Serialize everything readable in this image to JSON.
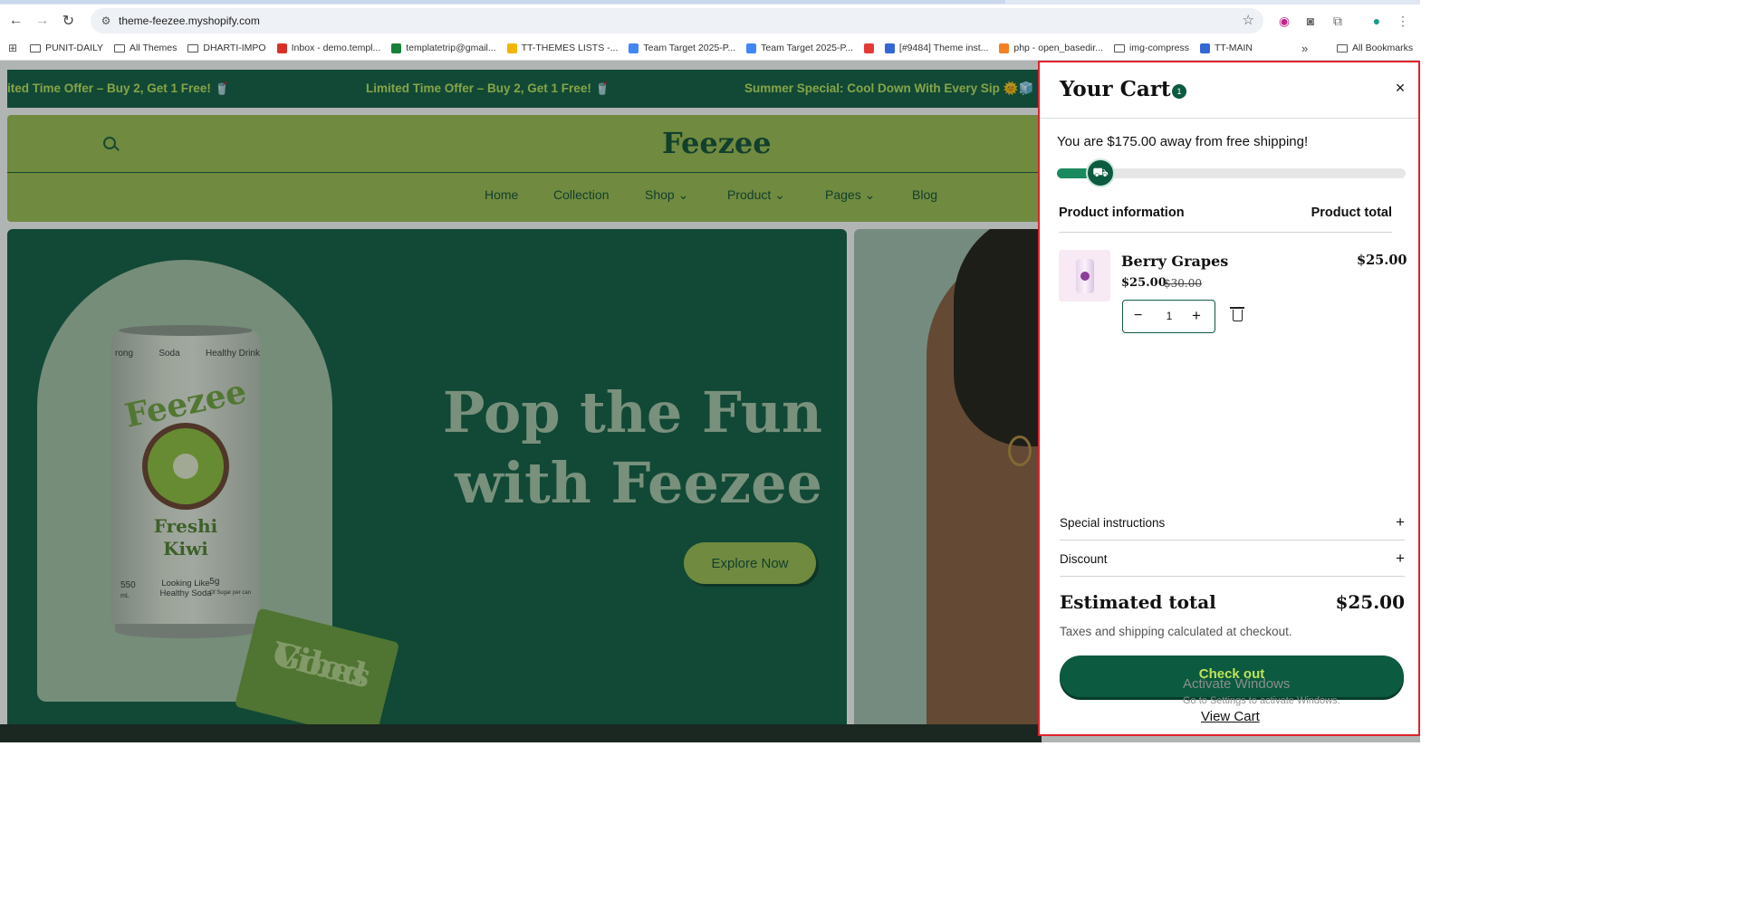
{
  "browser": {
    "url": "theme-feezee.myshopify.com",
    "bookmarks": [
      {
        "label": "PUNIT-DAILY",
        "kind": "folder"
      },
      {
        "label": "All Themes",
        "kind": "folder"
      },
      {
        "label": "DHARTI-IMPO",
        "kind": "folder"
      },
      {
        "label": "Inbox - demo.templ...",
        "kind": "gmail"
      },
      {
        "label": "templatetrip@gmail...",
        "kind": "sheets"
      },
      {
        "label": "TT-THEMES LISTS -...",
        "kind": "drive"
      },
      {
        "label": "Team Target 2025-P...",
        "kind": "docs"
      },
      {
        "label": "Team Target 2025-P...",
        "kind": "docs"
      },
      {
        "label": "",
        "kind": "red"
      },
      {
        "label": "[#9484] Theme inst...",
        "kind": "site"
      },
      {
        "label": "php - open_basedir...",
        "kind": "stack"
      },
      {
        "label": "img-compress",
        "kind": "folder"
      },
      {
        "label": "TT-MAIN",
        "kind": "site"
      }
    ],
    "overflow_label": "»",
    "all_bookmarks_label": "All Bookmarks"
  },
  "page": {
    "announcements": [
      "ited Time Offer – Buy 2, Get 1 Free! 🥤",
      "Limited Time Offer – Buy 2, Get 1 Free! 🥤",
      "Summer Special: Cool Down With Every Sip 🌞🧊"
    ],
    "logo": "Feezee",
    "menu": [
      {
        "label": "Home"
      },
      {
        "label": "Collection"
      },
      {
        "label": "Shop ⌄"
      },
      {
        "label": "Product ⌄"
      },
      {
        "label": "Pages ⌄"
      },
      {
        "label": "Blog"
      }
    ],
    "hero": {
      "title_line1": "Pop the Fun",
      "title_line2": "with Feezee",
      "cta": "Explore Now",
      "can": {
        "tags": [
          "rong",
          "Soda",
          "Healthy Drink"
        ],
        "brand": "Feezee",
        "flavor_line1": "Freshi",
        "flavor_line2": "Kiwi",
        "volume": "550",
        "volume_unit": "mL",
        "tagline_line1": "Looking Like",
        "tagline_line2": "Healthy Soda",
        "sugar": "5g",
        "sugar_note": "Of Sugar per can"
      },
      "sticker_line1": "Good",
      "sticker_line2": "Vibes"
    }
  },
  "cart": {
    "title": "Your Cart",
    "count": "1",
    "close_icon": "×",
    "shipping_message": "You are $175.00 away from free shipping!",
    "shipping_progress": 0.125,
    "col_left": "Product information",
    "col_right": "Product total",
    "item": {
      "name": "Berry Grapes",
      "price": "$25.00",
      "compare_price": "$30.00",
      "line_total": "$25.00",
      "quantity": "1"
    },
    "special_instructions": "Special instructions",
    "discount": "Discount",
    "estimated_total_label": "Estimated total",
    "estimated_total_value": "$25.00",
    "tax_note": "Taxes and shipping calculated at checkout.",
    "checkout": "Check out",
    "view_cart": "View Cart"
  },
  "os_watermark": {
    "title": "Activate Windows",
    "subtitle": "Go to Settings to activate Windows."
  },
  "colors": {
    "brand_dark": "#0c5a3f",
    "brand_lime": "#9dbe4e",
    "accent_red": "#e0232b"
  }
}
